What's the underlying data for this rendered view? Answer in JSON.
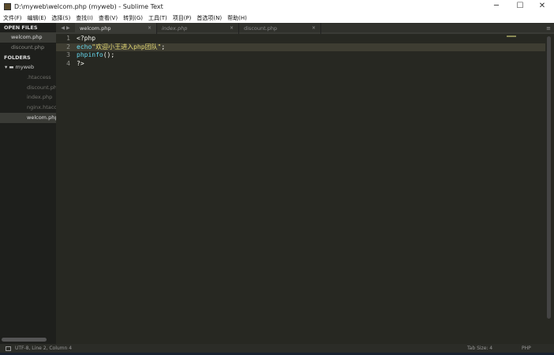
{
  "window": {
    "title": "D:\\myweb\\welcom.php (myweb) - Sublime Text",
    "minimize": "─",
    "maximize": "☐",
    "close": "✕"
  },
  "menu": [
    "文件(F)",
    "编辑(E)",
    "选择(S)",
    "查找(I)",
    "查看(V)",
    "转到(G)",
    "工具(T)",
    "项目(P)",
    "首选项(N)",
    "帮助(H)"
  ],
  "sidebar": {
    "open_files_label": "OPEN FILES",
    "open_files": [
      "welcom.php",
      "discount.php"
    ],
    "folders_label": "FOLDERS",
    "folder": "myweb",
    "files": [
      ".htaccess",
      "discount.php",
      "index.php",
      "nginx.htaccess",
      "welcom.php"
    ]
  },
  "tabs": [
    {
      "label": "welcom.php",
      "close": "×"
    },
    {
      "label": "index.php",
      "close": "×"
    },
    {
      "label": "discount.php",
      "close": "×"
    }
  ],
  "tabnav": "◀ ▶",
  "tabmenu": "≡",
  "code": {
    "line_numbers": [
      "1",
      "2",
      "3",
      "4"
    ],
    "l1": "<?php",
    "l2a": "echo",
    "l2b": "\"欢迎小王进入php团队\"",
    "l2c": ";",
    "l3a": "phpinfo",
    "l3b": "();",
    "l4": "?>"
  },
  "status": {
    "left": "UTF-8, Line 2, Column 4",
    "tab_size": "Tab Size: 4",
    "syntax": "PHP"
  }
}
